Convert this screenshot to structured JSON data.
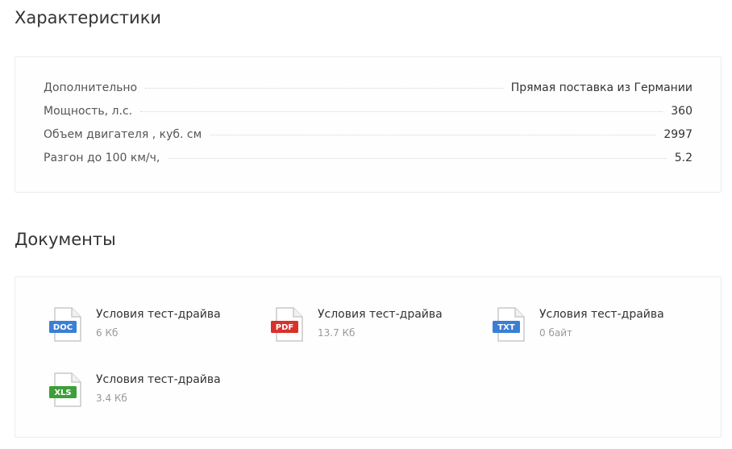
{
  "specs": {
    "title": "Характеристики",
    "rows": [
      {
        "name": "Дополнительно",
        "value": "Прямая поставка из Германии"
      },
      {
        "name": "Мощность, л.с.",
        "value": "360"
      },
      {
        "name": "Объем двигателя , куб. см",
        "value": "2997"
      },
      {
        "name": "Разгон до 100 км/ч,",
        "value": "5.2"
      }
    ]
  },
  "documents": {
    "title": "Документы",
    "items": [
      {
        "name": "Условия тест-драйва",
        "size": "6 Кб",
        "type": "DOC",
        "color": "#3a7fd5",
        "icon": "doc-file-icon"
      },
      {
        "name": "Условия тест-драйва",
        "size": "13.7 Кб",
        "type": "PDF",
        "color": "#d8312b",
        "icon": "pdf-file-icon"
      },
      {
        "name": "Условия тест-драйва",
        "size": "0 байт",
        "type": "TXT",
        "color": "#3a7fd5",
        "icon": "txt-file-icon"
      },
      {
        "name": "Условия тест-драйва",
        "size": "3.4 Кб",
        "type": "XLS",
        "color": "#3e9e3a",
        "icon": "xls-file-icon"
      }
    ]
  }
}
